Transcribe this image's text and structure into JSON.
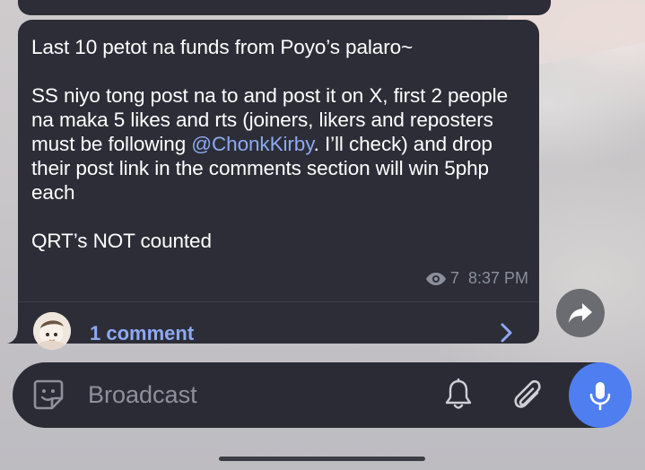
{
  "message": {
    "line1": "Last 10 petot na funds from Poyo’s palaro~",
    "body_before_mention": "SS niyo tong post na to and post it on X, first 2 people na maka 5 likes and rts (joiners, likers and reposters must be following ",
    "mention": "@ChonkKirby",
    "body_after_mention": ". I’ll check) and drop their post link in the comments section will win 5php each",
    "footer_line": "QRT’s NOT counted",
    "views": "7",
    "time": "8:37 PM"
  },
  "comments": {
    "label": "1 comment"
  },
  "composer": {
    "placeholder": "Broadcast"
  },
  "icons": {
    "views": "eye-icon",
    "open_comments": "chevron-right-icon",
    "share": "share-forward-icon",
    "sticker": "sticker-icon",
    "notifications": "bell-icon",
    "attach": "paperclip-icon",
    "record": "microphone-icon"
  },
  "colors": {
    "bubble": "#2c2d37",
    "link": "#8ea9f2",
    "meta": "#8b8f9c",
    "mic_button": "#4f7ef0",
    "input_bar": "#2a2b34"
  }
}
